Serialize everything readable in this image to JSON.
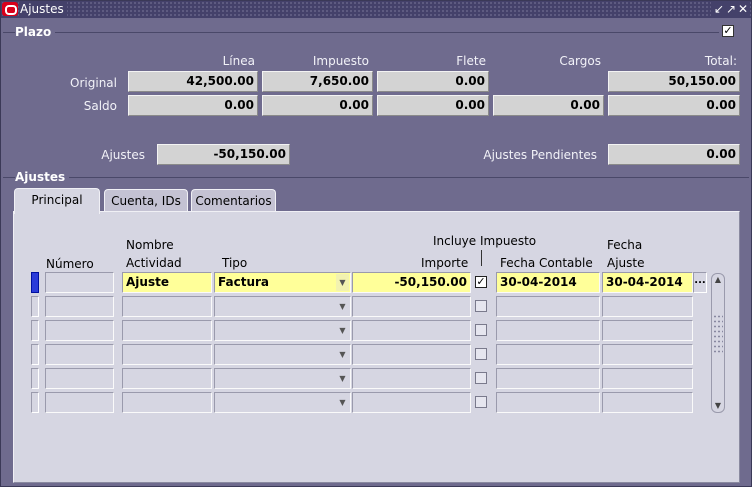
{
  "window": {
    "title": "Ajustes",
    "buttons": [
      "minimize-icon",
      "maximize-icon",
      "close-icon"
    ],
    "colors": {
      "frame": "#6f6b8e",
      "titlebar": "#44416a",
      "field": "#d3d3d3",
      "highlight": "#ffff99",
      "current_row": "#2a3bd9"
    }
  },
  "plazo": {
    "title": "Plazo",
    "expanded": true,
    "headers": {
      "linea": "Línea",
      "impuesto": "Impuesto",
      "flete": "Flete",
      "cargos": "Cargos",
      "total": "Total:"
    },
    "original": {
      "label": "Original",
      "linea": "42,500.00",
      "impuesto": "7,650.00",
      "flete": "0.00",
      "total": "50,150.00"
    },
    "saldo": {
      "label": "Saldo",
      "linea": "0.00",
      "impuesto": "0.00",
      "flete": "0.00",
      "cargos": "0.00",
      "total": "0.00"
    },
    "ajustes_label": "Ajustes",
    "ajustes_value": "-50,150.00",
    "pendientes_label": "Ajustes Pendientes",
    "pendientes_value": "0.00"
  },
  "ajustes": {
    "title": "Ajustes",
    "tabs": [
      {
        "label": "Principal",
        "active": true
      },
      {
        "label": "Cuenta, IDs",
        "active": false
      },
      {
        "label": "Comentarios",
        "active": false
      }
    ],
    "columns": {
      "numero": "Número",
      "nombre_actividad_1": "Nombre",
      "nombre_actividad_2": "Actividad",
      "tipo": "Tipo",
      "incluye_impuesto": "Incluye Impuesto",
      "importe": "Importe",
      "fecha_contable": "Fecha Contable",
      "fecha_ajuste_1": "Fecha",
      "fecha_ajuste_2": "Ajuste"
    },
    "rows": [
      {
        "numero": "",
        "actividad": "Ajuste",
        "tipo": "Factura",
        "importe": "-50,150.00",
        "incluye_impuesto": true,
        "fecha_contable": "30-04-2014",
        "fecha_ajuste": "30-04-2014",
        "current": true
      },
      {
        "numero": "",
        "actividad": "",
        "tipo": "",
        "importe": "",
        "incluye_impuesto": false,
        "fecha_contable": "",
        "fecha_ajuste": "",
        "current": false
      },
      {
        "numero": "",
        "actividad": "",
        "tipo": "",
        "importe": "",
        "incluye_impuesto": false,
        "fecha_contable": "",
        "fecha_ajuste": "",
        "current": false
      },
      {
        "numero": "",
        "actividad": "",
        "tipo": "",
        "importe": "",
        "incluye_impuesto": false,
        "fecha_contable": "",
        "fecha_ajuste": "",
        "current": false
      },
      {
        "numero": "",
        "actividad": "",
        "tipo": "",
        "importe": "",
        "incluye_impuesto": false,
        "fecha_contable": "",
        "fecha_ajuste": "",
        "current": false
      },
      {
        "numero": "",
        "actividad": "",
        "tipo": "",
        "importe": "",
        "incluye_impuesto": false,
        "fecha_contable": "",
        "fecha_ajuste": "",
        "current": false
      }
    ],
    "lov_button": "..."
  }
}
